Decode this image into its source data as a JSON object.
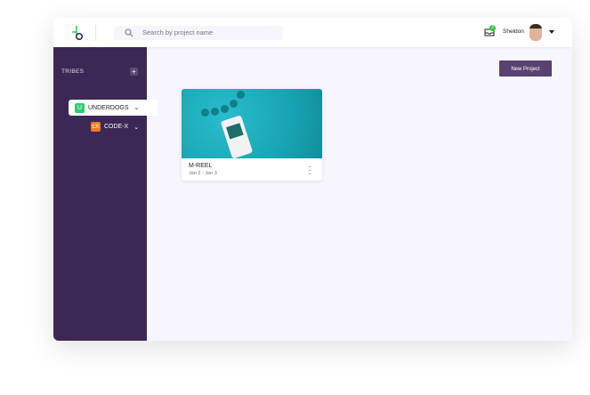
{
  "header": {
    "search_placeholder": "Search by project name",
    "user_name": "Sheldon",
    "notification_count": "3"
  },
  "sidebar": {
    "section_label": "TRIBES",
    "add_label": "+",
    "tribes": [
      {
        "icon": "U",
        "label": "UNDERDOGS",
        "color": "#2ecc71"
      },
      {
        "icon": "cX",
        "label": "CODE-X",
        "color": "#f07a1e"
      }
    ]
  },
  "main": {
    "new_project_label": "New Project",
    "projects": [
      {
        "title": "M-REEL",
        "dates": "Jan 2 - Jan 3"
      }
    ]
  }
}
